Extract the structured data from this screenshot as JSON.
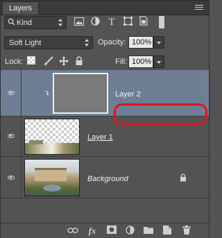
{
  "panel": {
    "tab_label": "Layers"
  },
  "filter": {
    "kind_label": "Kind",
    "icons": [
      "image-icon",
      "adjustment-icon",
      "text-icon",
      "shape-icon",
      "smart-object-icon"
    ]
  },
  "blend": {
    "mode": "Soft Light",
    "opacity_label": "Opacity:",
    "opacity_value": "100%"
  },
  "lock": {
    "label": "Lock:",
    "icons": [
      "lock-transparent-icon",
      "lock-paint-icon",
      "lock-position-icon",
      "lock-all-icon"
    ],
    "fill_label": "Fill:",
    "fill_value": "100%"
  },
  "layers": [
    {
      "name": "Layer 2",
      "thumb": "gray",
      "selected": true
    },
    {
      "name": "Layer 1",
      "thumb": "transparent-partial"
    },
    {
      "name": "Background",
      "thumb": "photo",
      "locked": true
    }
  ],
  "footer": {
    "icons": [
      "link-icon",
      "fx-icon",
      "mask-icon",
      "adjustment-layer-icon",
      "group-icon",
      "new-layer-icon",
      "trash-icon"
    ],
    "fx_label": "fx"
  },
  "colors": {
    "panel": "#535353",
    "selected_row": "#6e7f95",
    "highlight": "#e0131a"
  }
}
